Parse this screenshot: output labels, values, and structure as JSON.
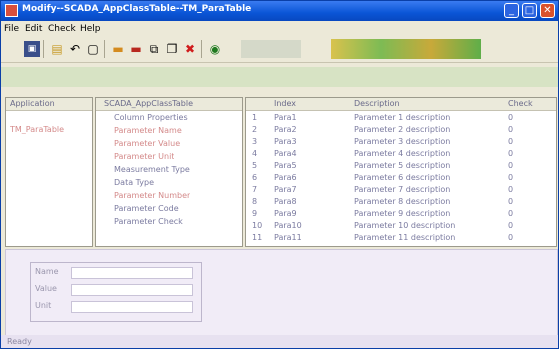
{
  "window": {
    "title": "Modify--SCADA_AppClassTable--TM_ParaTable",
    "colors": {
      "titlebar": "#0a55d6",
      "window_bg": "#ece9d8"
    }
  },
  "menu": [
    "File",
    "Edit",
    "Check",
    "Help"
  ],
  "toolbar": {
    "buttons": [
      "save-icon",
      "open-icon",
      "undo-icon",
      "new-icon",
      "insert-row-icon",
      "delete-row-icon",
      "copy-icon",
      "paste-icon",
      "delete-icon",
      "help-icon"
    ]
  },
  "left_pane": {
    "header": "Application",
    "item": "TM_ParaTable"
  },
  "mid_pane": {
    "header": "SCADA_AppClassTable",
    "rows": [
      "Column Properties",
      "Parameter Name",
      "Parameter Value",
      "Parameter Unit",
      "Measurement Type",
      "Data Type",
      "Parameter Number",
      "Parameter Code",
      "Parameter Check"
    ]
  },
  "right_pane": {
    "headers": [
      "Index",
      "Description",
      "Check"
    ],
    "rows": [
      {
        "index": "1",
        "name": "Para1",
        "desc": "Parameter 1 description",
        "check": "0"
      },
      {
        "index": "2",
        "name": "Para2",
        "desc": "Parameter 2 description",
        "check": "0"
      },
      {
        "index": "3",
        "name": "Para3",
        "desc": "Parameter 3 description",
        "check": "0"
      },
      {
        "index": "4",
        "name": "Para4",
        "desc": "Parameter 4 description",
        "check": "0"
      },
      {
        "index": "5",
        "name": "Para5",
        "desc": "Parameter 5 description",
        "check": "0"
      },
      {
        "index": "6",
        "name": "Para6",
        "desc": "Parameter 6 description",
        "check": "0"
      },
      {
        "index": "7",
        "name": "Para7",
        "desc": "Parameter 7 description",
        "check": "0"
      },
      {
        "index": "8",
        "name": "Para8",
        "desc": "Parameter 8 description",
        "check": "0"
      },
      {
        "index": "9",
        "name": "Para9",
        "desc": "Parameter 9 description",
        "check": "0"
      },
      {
        "index": "10",
        "name": "Para10",
        "desc": "Parameter 10 description",
        "check": "0"
      },
      {
        "index": "11",
        "name": "Para11",
        "desc": "Parameter 11 description",
        "check": "0"
      }
    ]
  },
  "bottom": {
    "fields": [
      "Name",
      "Value",
      "Unit"
    ]
  },
  "status": {
    "text": "Ready"
  }
}
